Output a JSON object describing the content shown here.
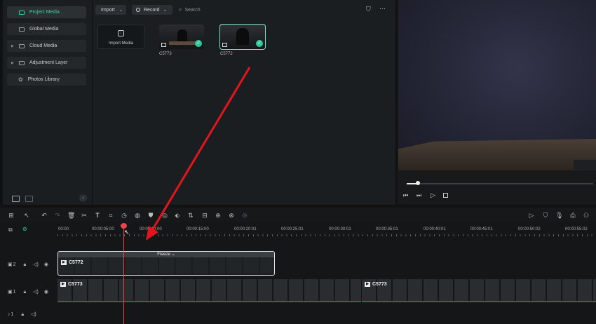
{
  "sidebar": {
    "items": [
      {
        "label": "Project Media",
        "active": true,
        "expandable": false
      },
      {
        "label": "Global Media",
        "active": false,
        "expandable": false
      },
      {
        "label": "Cloud Media",
        "active": false,
        "expandable": true
      },
      {
        "label": "Adjustment Layer",
        "active": false,
        "expandable": true
      },
      {
        "label": "Photos Library",
        "active": false,
        "expandable": false
      }
    ]
  },
  "media_toolbar": {
    "import_label": "Import",
    "record_label": "Record",
    "search_placeholder": "Search"
  },
  "media": {
    "import_tile_label": "Import Media",
    "items": [
      {
        "name": "C5773",
        "selected": false
      },
      {
        "name": "C5772",
        "selected": true
      }
    ]
  },
  "preview": {
    "progress": 0.06
  },
  "timeline": {
    "ruler_labels": [
      "00:00",
      "00:00:05:00",
      "00:00:10:00",
      "00:00:15:00",
      "00:00:20:01",
      "00:00:25:01",
      "00:00:30:01",
      "00:00:35:01",
      "00:00:40:01",
      "00:00:45:01",
      "00:00:50:02",
      "00:00:55:02"
    ],
    "tracks": [
      {
        "number": "2",
        "type": "video"
      },
      {
        "number": "1",
        "type": "video"
      },
      {
        "number": "1",
        "type": "audio"
      }
    ],
    "clips": {
      "track2_clip": {
        "name": "C5772",
        "badge": "Freeze"
      },
      "track1_clip_a": {
        "name": "C5773"
      },
      "track1_clip_b": {
        "name": "C5773"
      }
    }
  },
  "colors": {
    "accent": "#38d4a8",
    "playhead": "#e8454f",
    "annotation_arrow": "#e3151c"
  }
}
